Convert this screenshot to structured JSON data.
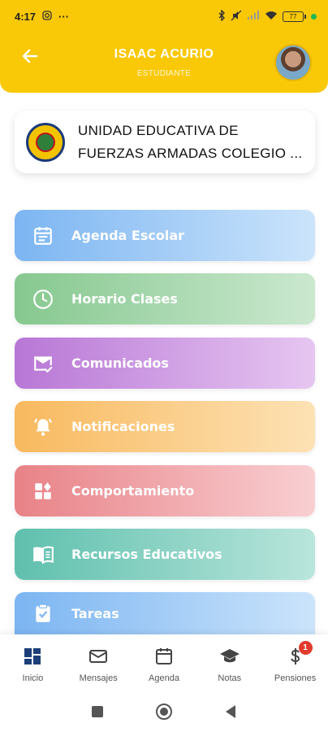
{
  "status_bar": {
    "time": "4:17",
    "battery": "77",
    "colors": {
      "background": "#f9c807"
    }
  },
  "header": {
    "user_name": "ISAAC ACURIO",
    "role": "ESTUDIANTE",
    "back_icon": "arrow-left-icon",
    "avatar_icon": "user-avatar"
  },
  "school": {
    "name": "UNIDAD EDUCATIVA DE FUERZAS ARMADAS COLEGIO ..."
  },
  "menu": {
    "items": [
      {
        "label": "Agenda Escolar",
        "icon": "calendar-icon",
        "color": "#7cb5f2"
      },
      {
        "label": "Horario Clases",
        "icon": "clock-icon",
        "color": "#86c88f"
      },
      {
        "label": "Comunicados",
        "icon": "mail-check-icon",
        "color": "#b877d6"
      },
      {
        "label": "Notificaciones",
        "icon": "bell-icon",
        "color": "#f8b95e"
      },
      {
        "label": "Comportamiento",
        "icon": "widgets-icon",
        "color": "#e88287"
      },
      {
        "label": "Recursos Educativos",
        "icon": "book-icon",
        "color": "#5fc0ad"
      },
      {
        "label": "Tareas",
        "icon": "clipboard-check-icon",
        "color": "#7cb5f2"
      }
    ]
  },
  "bottom_nav": {
    "items": [
      {
        "label": "Inicio",
        "icon": "dashboard-icon",
        "active": true
      },
      {
        "label": "Mensajes",
        "icon": "mail-icon"
      },
      {
        "label": "Agenda",
        "icon": "calendar-icon"
      },
      {
        "label": "Notas",
        "icon": "graduation-cap-icon"
      },
      {
        "label": "Pensiones",
        "icon": "dollar-icon",
        "badge": "1"
      }
    ]
  }
}
